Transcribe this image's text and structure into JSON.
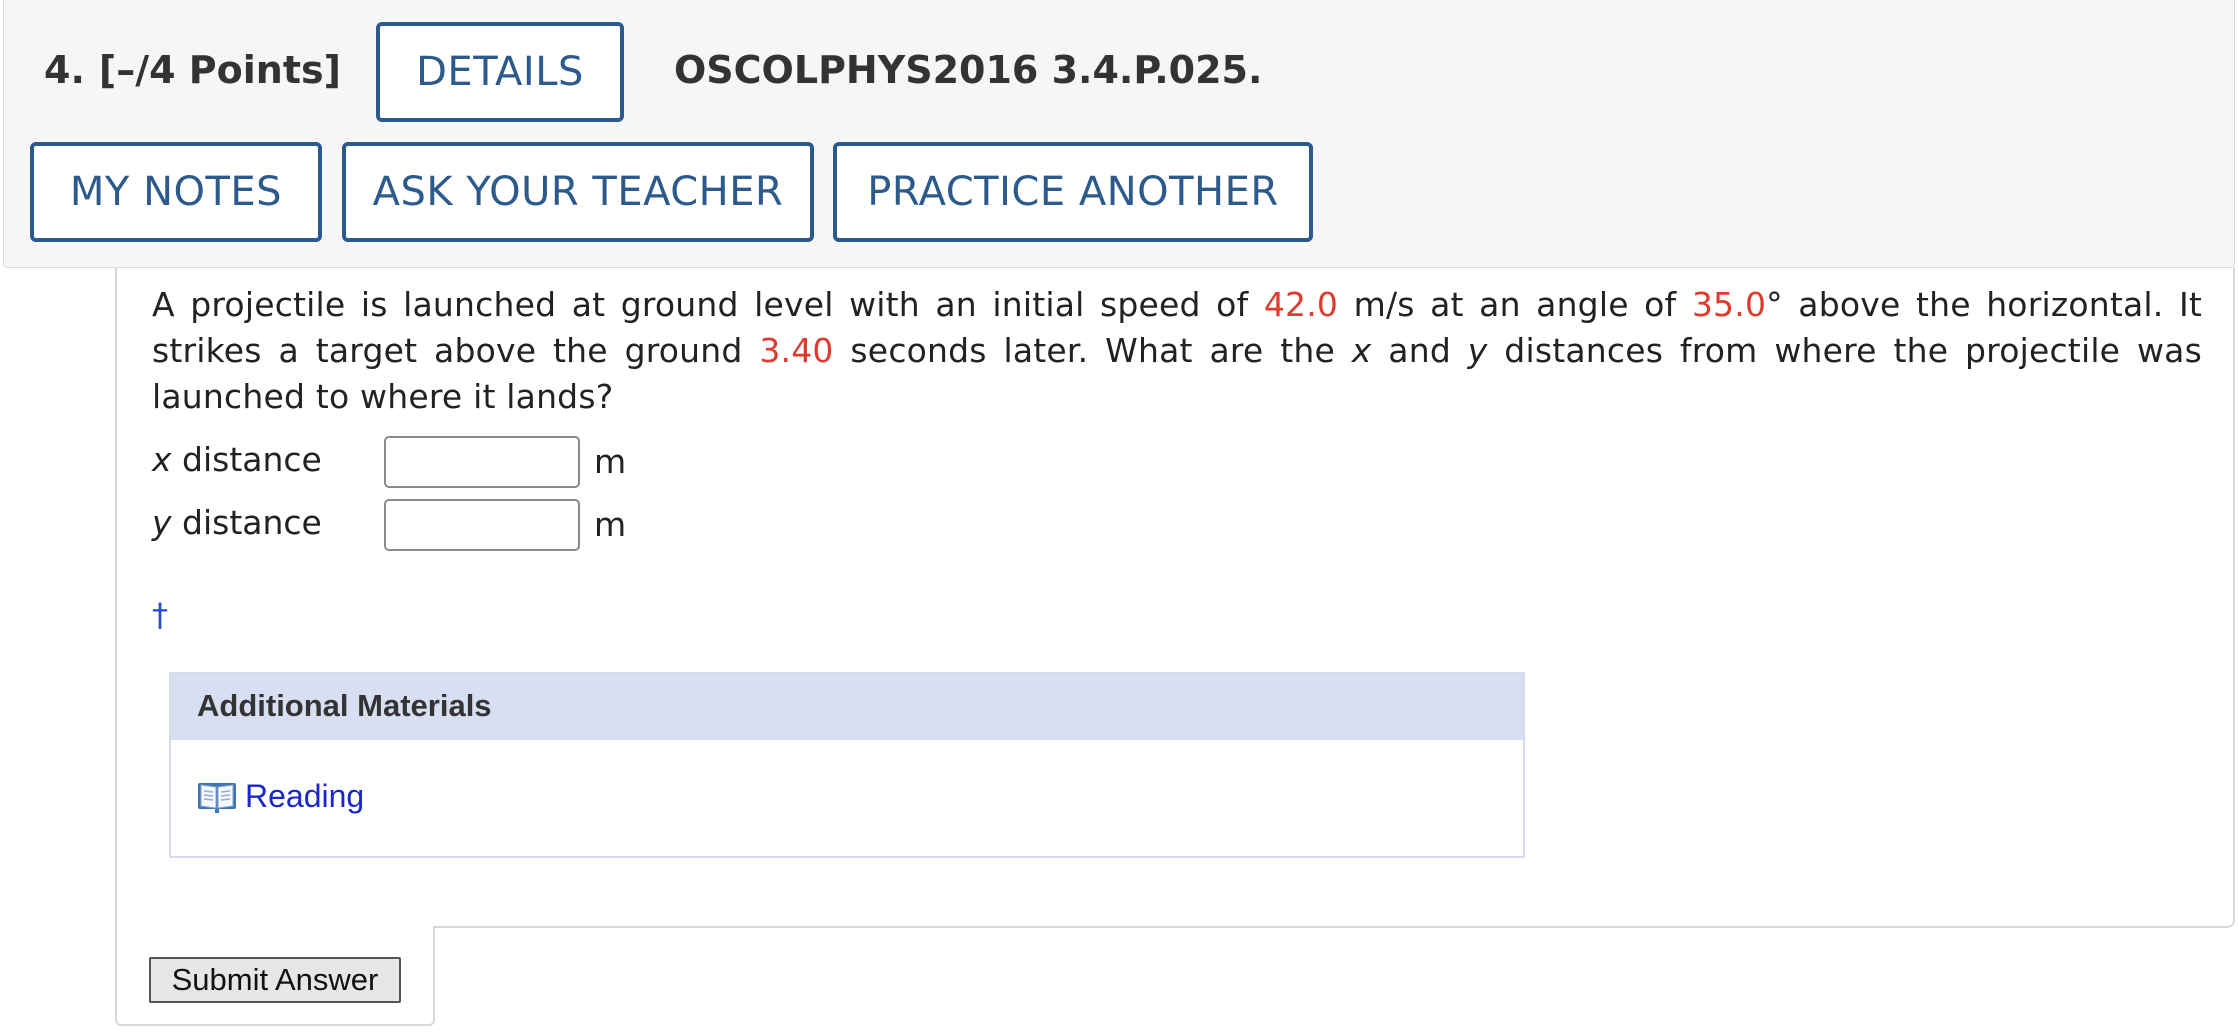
{
  "header": {
    "question_number": "4.",
    "points": "[–/4 Points]",
    "details_label": "DETAILS",
    "question_code": "OSCOLPHYS2016 3.4.P.025.",
    "my_notes_label": "MY NOTES",
    "ask_teacher_label": "ASK YOUR TEACHER",
    "practice_label": "PRACTICE ANOTHER"
  },
  "question": {
    "part1": "A projectile is launched at ground level with an initial speed of ",
    "speed": "42.0",
    "part2": " m/s at an angle of ",
    "angle": "35.0",
    "part3": "° above the horizontal. It strikes a target above the ground ",
    "time": "3.40",
    "part4": " seconds later. What are the ",
    "var_x": "x",
    "part5": " and ",
    "var_y": "y",
    "part6": " distances from where the projectile was launched to where it lands?"
  },
  "answers": {
    "x_var": "x",
    "x_label": " distance",
    "x_value": "",
    "x_unit": "m",
    "y_var": "y",
    "y_label": " distance",
    "y_value": "",
    "y_unit": "m"
  },
  "dagger": "†",
  "materials": {
    "header": "Additional Materials",
    "reading_label": "Reading",
    "reading_icon": "book-icon"
  },
  "submit_label": "Submit Answer",
  "colors": {
    "accent_blue": "#2c5a8c",
    "value_red": "#e03a2e",
    "link_blue": "#1a27c9",
    "materials_header_bg": "#d8dff3"
  }
}
